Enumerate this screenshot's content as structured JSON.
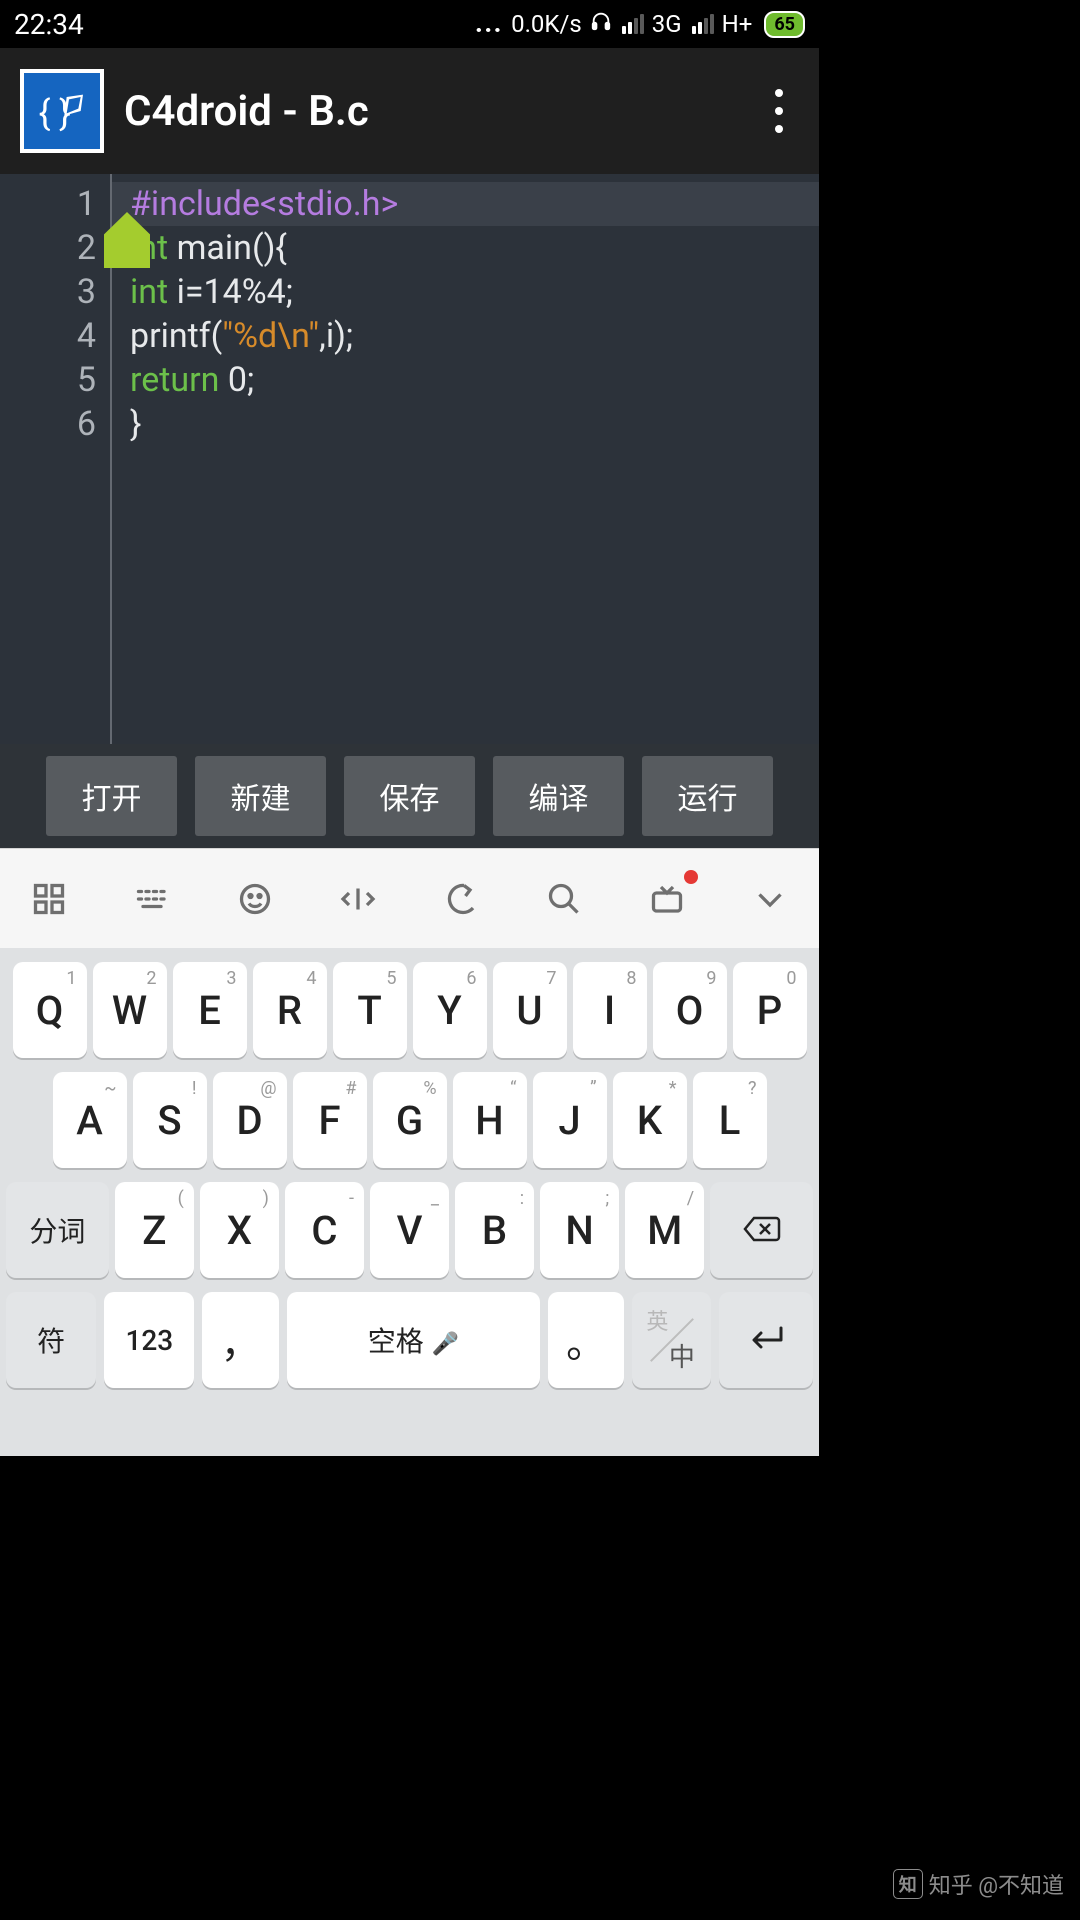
{
  "status": {
    "time": "22:34",
    "net_speed": "0.0K/s",
    "carrier1": "3G",
    "carrier2": "H+",
    "battery": "65"
  },
  "header": {
    "title": "C4droid - B.c"
  },
  "editor": {
    "line_numbers": [
      "1",
      "2",
      "3",
      "4",
      "5",
      "6"
    ],
    "code": {
      "l1_pre": "#include<stdio.h>",
      "l2_kw": "int",
      "l2_rest": " main(){",
      "l3_kw": "int",
      "l3_rest": " i=14%4;",
      "l4_a": "printf(",
      "l4_str": "\"%d\\n\"",
      "l4_b": ",i);",
      "l5_kw": "return",
      "l5_rest": " 0;",
      "l6": "}"
    }
  },
  "actions": [
    "打开",
    "新建",
    "保存",
    "编译",
    "运行"
  ],
  "keyboard": {
    "row1": [
      {
        "m": "Q",
        "a": "1"
      },
      {
        "m": "W",
        "a": "2"
      },
      {
        "m": "E",
        "a": "3"
      },
      {
        "m": "R",
        "a": "4"
      },
      {
        "m": "T",
        "a": "5"
      },
      {
        "m": "Y",
        "a": "6"
      },
      {
        "m": "U",
        "a": "7"
      },
      {
        "m": "I",
        "a": "8"
      },
      {
        "m": "O",
        "a": "9"
      },
      {
        "m": "P",
        "a": "0"
      }
    ],
    "row2": [
      {
        "m": "A",
        "a": "~"
      },
      {
        "m": "S",
        "a": "!"
      },
      {
        "m": "D",
        "a": "@"
      },
      {
        "m": "F",
        "a": "#"
      },
      {
        "m": "G",
        "a": "%"
      },
      {
        "m": "H",
        "a": "“"
      },
      {
        "m": "J",
        "a": "”"
      },
      {
        "m": "K",
        "a": "*"
      },
      {
        "m": "L",
        "a": "?"
      }
    ],
    "row3": {
      "seg": "分词",
      "keys": [
        {
          "m": "Z",
          "a": "("
        },
        {
          "m": "X",
          "a": ")"
        },
        {
          "m": "C",
          "a": "-"
        },
        {
          "m": "V",
          "a": "_"
        },
        {
          "m": "B",
          "a": ":"
        },
        {
          "m": "N",
          "a": ";"
        },
        {
          "m": "M",
          "a": "/"
        }
      ]
    },
    "row4": {
      "symbols": "符",
      "numbers": "123",
      "comma": "，",
      "space": "空格",
      "period": "。",
      "lang_en": "英",
      "lang_zh": "中"
    }
  },
  "watermark": {
    "logo_text": "知",
    "text": "知乎 @不知道"
  }
}
